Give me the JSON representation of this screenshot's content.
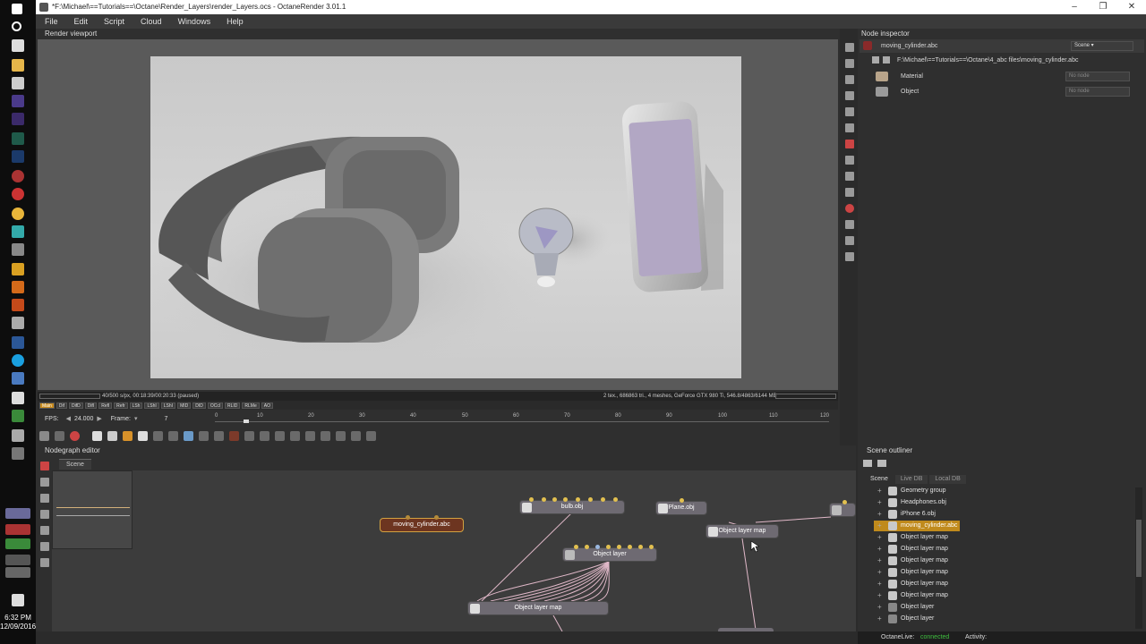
{
  "window": {
    "title": "*F:\\Michael\\==Tutorials==\\Octane\\Render_Layers\\render_Layers.ocs - OctaneRender 3.01.1"
  },
  "menu": [
    "File",
    "Edit",
    "Script",
    "Cloud",
    "Windows",
    "Help"
  ],
  "taskbar": {
    "time": "6:32 PM",
    "date": "12/09/2016"
  },
  "viewport": {
    "title": "Render viewport",
    "status_left": "40/500 s/px, 00:18:39/00:20:33 (paused)",
    "status_right": "2 tex., 686863 tri., 4 meshes, GeForce GTX 980 Ti, 546.8/4863/6144 MB",
    "passes": [
      "Main",
      "Dif",
      "DifD",
      "DifI",
      "Refl",
      "Refr",
      "LSh",
      "LShI",
      "LShI",
      "MID",
      "DID",
      "OCcl",
      "RLID",
      "RLMe",
      "AO"
    ],
    "fps_label": "FPS:",
    "fps_value": "24.000",
    "frame_label": "Frame:",
    "frame_value": "7",
    "timeline_ticks": [
      "0",
      "10",
      "20",
      "30",
      "40",
      "50",
      "60",
      "70",
      "80",
      "90",
      "100",
      "110",
      "120"
    ]
  },
  "inspector": {
    "title": "Node inspector",
    "node_name": "moving_cylinder.abc",
    "scene_combo": "Scene",
    "file_path": "F:\\Michael\\==Tutorials==\\Octane\\4_abc files\\moving_cylinder.abc",
    "rows": [
      {
        "label": "Material",
        "value": "No node"
      },
      {
        "label": "Object",
        "value": "No node"
      }
    ]
  },
  "nodegraph": {
    "title": "Nodegraph editor",
    "tab": "Scene",
    "nodes": {
      "moving_cylinder": "moving_cylinder.abc",
      "bulb": "bulb.obj",
      "plane": "Plane.obj",
      "object_layer_map_1": "Object layer map",
      "object_layer": "Object layer",
      "object_layer_map_2": "Object layer map"
    }
  },
  "outliner": {
    "title": "Scene outliner",
    "tabs": [
      "Scene",
      "Live DB",
      "Local DB"
    ],
    "items": [
      {
        "label": "Geometry group",
        "selected": false
      },
      {
        "label": "Headphones.obj",
        "selected": false
      },
      {
        "label": "iPhone 6.obj",
        "selected": false
      },
      {
        "label": "moving_cylinder.abc",
        "selected": true
      },
      {
        "label": "Object layer map",
        "selected": false
      },
      {
        "label": "Object layer map",
        "selected": false
      },
      {
        "label": "Object layer map",
        "selected": false
      },
      {
        "label": "Object layer map",
        "selected": false
      },
      {
        "label": "Object layer map",
        "selected": false
      },
      {
        "label": "Object layer map",
        "selected": false
      },
      {
        "label": "Object layer",
        "selected": false
      },
      {
        "label": "Object layer",
        "selected": false
      }
    ]
  },
  "status": {
    "octanelive_label": "OctaneLive:",
    "octanelive_value": "connected",
    "activity_label": "Activity:"
  },
  "colors": {
    "accent": "#c08a1c",
    "connected": "#3fbf3f"
  }
}
